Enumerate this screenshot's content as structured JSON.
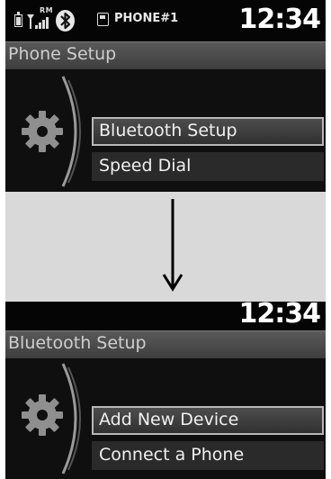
{
  "status": {
    "roaming_label": "RM",
    "device_name": "PHONE#1",
    "clock": "12:34"
  },
  "screen1": {
    "title": "Phone Setup",
    "menu": [
      {
        "label": "Bluetooth Setup",
        "selected": true
      },
      {
        "label": "Speed Dial",
        "selected": false
      }
    ]
  },
  "screen2": {
    "clock": "12:34",
    "title": "Bluetooth Setup",
    "menu": [
      {
        "label": "Add New Device",
        "selected": true
      },
      {
        "label": "Connect a Phone",
        "selected": false
      }
    ]
  },
  "icons": {
    "battery": "battery-icon",
    "signal": "signal-strength-icon",
    "bluetooth": "bluetooth-icon",
    "phone": "phone-icon",
    "gear": "gear-icon",
    "arrow": "arrow-down-icon"
  }
}
